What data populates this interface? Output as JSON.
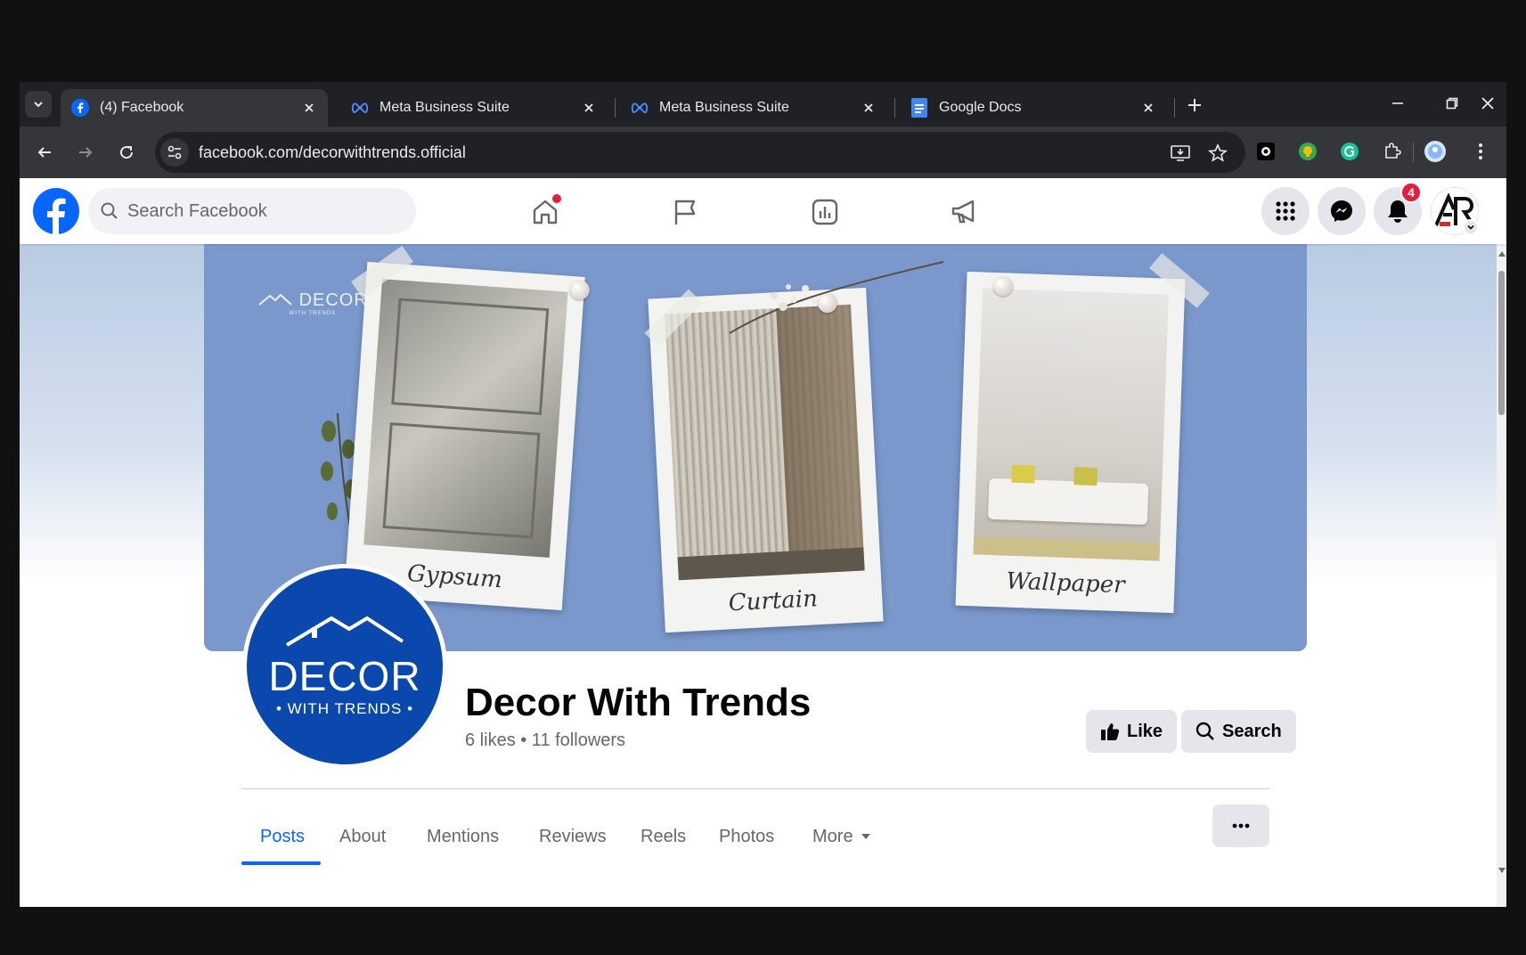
{
  "browser": {
    "tabs": [
      {
        "title": "(4) Facebook",
        "favicon": "facebook-icon",
        "active": true
      },
      {
        "title": "Meta Business Suite",
        "favicon": "meta-icon",
        "active": false
      },
      {
        "title": "Meta Business Suite",
        "favicon": "meta-icon",
        "active": false
      },
      {
        "title": "Google Docs",
        "favicon": "google-docs-icon",
        "active": false
      }
    ],
    "url": "facebook.com/decorwithtrends.official",
    "colors": {
      "tabstrip": "#202124",
      "toolbar": "#35363a",
      "text": "#e8eaed"
    }
  },
  "fb_header": {
    "search_placeholder": "Search Facebook",
    "nav_icons": [
      "home-icon",
      "flag-icon",
      "insights-icon",
      "megaphone-icon"
    ],
    "notification_count": "4",
    "colors": {
      "brand": "#0866ff",
      "badge": "#e41e3f"
    }
  },
  "cover": {
    "logo_text": "DECOR",
    "logo_sub": "WITH TRENDS",
    "captions": [
      "Gypsum",
      "Curtain",
      "Wallpaper"
    ]
  },
  "page": {
    "avatar_title": "DECOR",
    "avatar_subtitle": "• WITH TRENDS •",
    "name": "Decor With Trends",
    "stats": "6 likes • 11 followers",
    "like_label": "Like",
    "search_label": "Search",
    "tabs": [
      "Posts",
      "About",
      "Mentions",
      "Reviews",
      "Reels",
      "Photos",
      "More"
    ],
    "active_tab": "Posts",
    "colors": {
      "avatar_bg": "#0a48ad",
      "cover_bg": "#7a98cc"
    }
  }
}
